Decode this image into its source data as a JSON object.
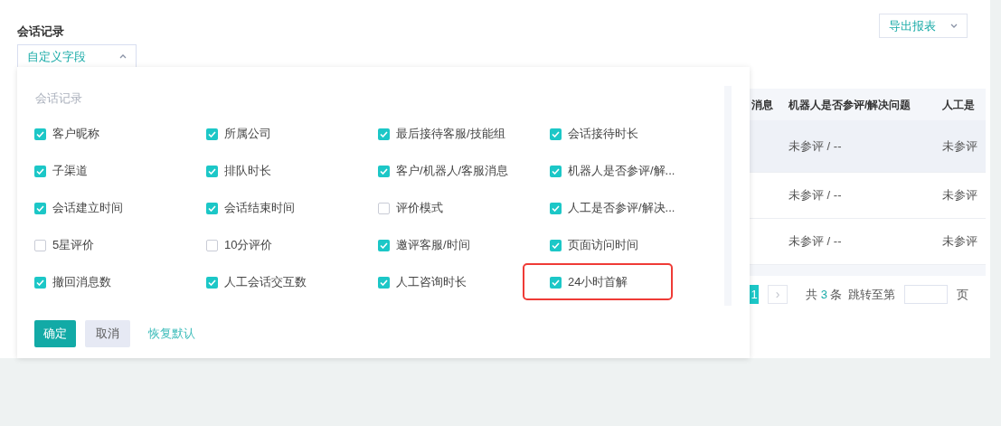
{
  "title": "会话记录",
  "field_picker": {
    "label": "自定义字段",
    "expanded": true
  },
  "export_button": {
    "label": "导出报表"
  },
  "table": {
    "columns": [
      "消息",
      "机器人是否参评/解决问题",
      "人工是"
    ],
    "rows": [
      {
        "hovered": true,
        "cells": [
          "",
          "未参评 / --",
          "未参评"
        ]
      },
      {
        "hovered": false,
        "cells": [
          "",
          "未参评 / --",
          "未参评"
        ]
      },
      {
        "hovered": false,
        "cells": [
          "",
          "未参评 / --",
          "未参评"
        ]
      }
    ]
  },
  "pagination": {
    "current_page": "1",
    "next": "›",
    "total_prefix": "共",
    "total": "3",
    "total_suffix": "条",
    "jump_label": "跳转至第",
    "page_suffix": "页"
  },
  "popup": {
    "group_title": "会话记录",
    "fields": [
      {
        "label": "客户昵称",
        "checked": true,
        "highlighted": false
      },
      {
        "label": "所属公司",
        "checked": true,
        "highlighted": false
      },
      {
        "label": "最后接待客服/技能组",
        "checked": true,
        "highlighted": false
      },
      {
        "label": "会话接待时长",
        "checked": true,
        "highlighted": false
      },
      {
        "label": "子渠道",
        "checked": true,
        "highlighted": false
      },
      {
        "label": "排队时长",
        "checked": true,
        "highlighted": false
      },
      {
        "label": "客户/机器人/客服消息",
        "checked": true,
        "highlighted": false
      },
      {
        "label": "机器人是否参评/解...",
        "checked": true,
        "highlighted": false
      },
      {
        "label": "会话建立时间",
        "checked": true,
        "highlighted": false
      },
      {
        "label": "会话结束时间",
        "checked": true,
        "highlighted": false
      },
      {
        "label": "评价模式",
        "checked": false,
        "highlighted": false
      },
      {
        "label": "人工是否参评/解决...",
        "checked": true,
        "highlighted": false
      },
      {
        "label": "5星评价",
        "checked": false,
        "highlighted": false
      },
      {
        "label": "10分评价",
        "checked": false,
        "highlighted": false
      },
      {
        "label": "邀评客服/时间",
        "checked": true,
        "highlighted": false
      },
      {
        "label": "页面访问时间",
        "checked": true,
        "highlighted": false
      },
      {
        "label": "撤回消息数",
        "checked": true,
        "highlighted": false
      },
      {
        "label": "人工会话交互数",
        "checked": true,
        "highlighted": false
      },
      {
        "label": "人工咨询时长",
        "checked": true,
        "highlighted": false
      },
      {
        "label": "24小时首解",
        "checked": true,
        "highlighted": true
      }
    ],
    "buttons": {
      "confirm": "确定",
      "cancel": "取消",
      "reset": "恢复默认"
    }
  }
}
